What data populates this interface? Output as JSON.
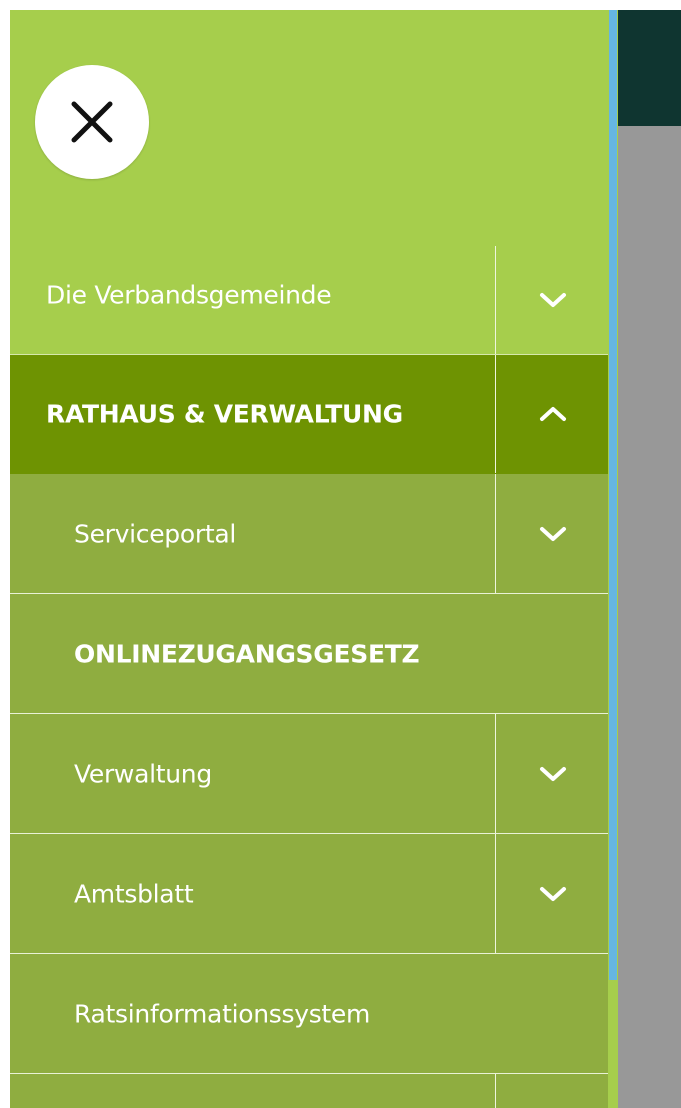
{
  "drawer": {
    "close_icon": "close-icon",
    "items": [
      {
        "label": "Die Verbandsgemeinde",
        "level": 1,
        "state": "collapsed",
        "icon": "chevron-down-icon"
      },
      {
        "label": "RATHAUS & VERWALTUNG",
        "level": 1,
        "state": "expanded",
        "icon": "chevron-up-icon"
      },
      {
        "label": "Serviceportal",
        "level": 2,
        "state": "collapsed",
        "icon": "chevron-down-icon"
      },
      {
        "label": "ONLINEZUGANGSGESETZ",
        "level": 2
      },
      {
        "label": "Verwaltung",
        "level": 2,
        "state": "collapsed",
        "icon": "chevron-down-icon"
      },
      {
        "label": "Amtsblatt",
        "level": 2,
        "state": "collapsed",
        "icon": "chevron-down-icon"
      },
      {
        "label": "Ratsinformationssystem",
        "level": 2
      }
    ]
  },
  "colors": {
    "drawer_bg": "#a6ce4c",
    "active_item_bg": "#6e9302",
    "sub_item_bg": "#8fad40",
    "header_bar": "#0f3530",
    "overlay": "#989898",
    "scroll_thumb": "#66b6e2"
  }
}
